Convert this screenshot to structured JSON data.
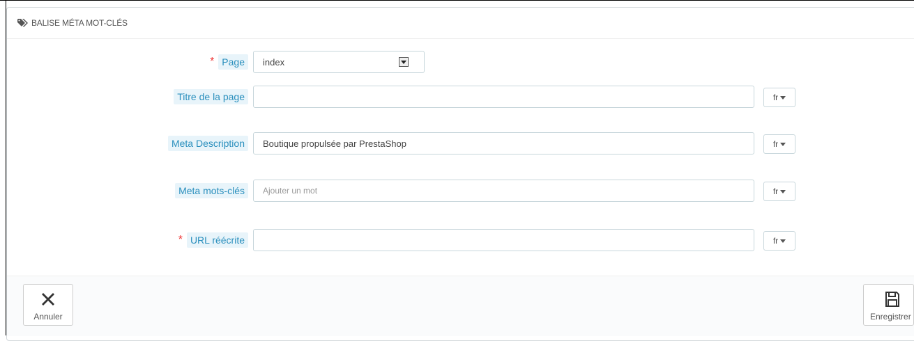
{
  "panel": {
    "title": "BALISE MÉTA MOT-CLÉS",
    "title_icon": "tags-icon"
  },
  "fields": {
    "page": {
      "label": "Page",
      "required": true,
      "value": "index"
    },
    "title": {
      "label": "Titre de la page",
      "value": "",
      "lang": "fr"
    },
    "description": {
      "label": "Meta Description",
      "value": "Boutique propulsée par PrestaShop",
      "lang": "fr"
    },
    "keywords": {
      "label": "Meta mots-clés",
      "placeholder": "Ajouter un mot",
      "lang": "fr"
    },
    "url": {
      "label": "URL réécrite",
      "required": true,
      "value": "",
      "lang": "fr"
    }
  },
  "required_mark": "*",
  "footer": {
    "cancel_label": "Annuler",
    "save_label": "Enregistrer"
  },
  "colors": {
    "label_bg": "#e8f4fa",
    "label_text": "#2a8fbd",
    "required": "#e33333"
  }
}
